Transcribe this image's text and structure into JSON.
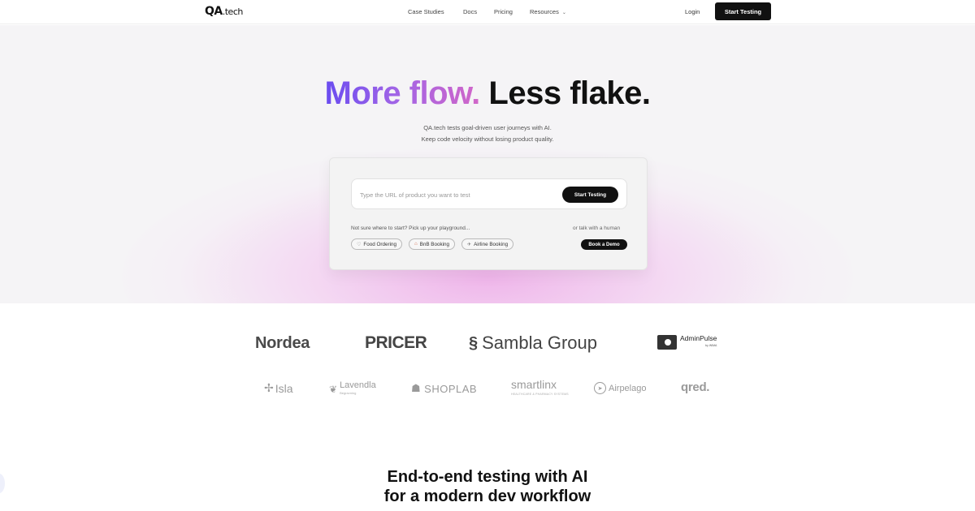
{
  "nav": {
    "logo_main": "QA",
    "logo_suffix": ".tech",
    "links": [
      "Case Studies",
      "Docs",
      "Pricing",
      "Resources"
    ],
    "login": "Login",
    "cta": "Start Testing"
  },
  "hero": {
    "headline_gradient": "More flow.",
    "headline_dark": "Less flake.",
    "subtitle_line1": "QA.tech tests goal-driven user journeys with AI.",
    "subtitle_line2": "Keep code velocity without losing product quality.",
    "url_placeholder": "Type the URL of product you want to test",
    "url_button": "Start Testing",
    "playground_text": "Not sure where to start? Pick up your playground...",
    "human_text": "or talk with a human",
    "chips": [
      "Food Ordering",
      "BnB Booking",
      "Airline Booking"
    ],
    "demo_button": "Book a Demo"
  },
  "logos": {
    "row1": [
      "Nordea",
      "PRICER",
      "Sambla Group",
      "AdminPulse"
    ],
    "adminpulse_byline": "by WIMA",
    "row2": [
      "Isla",
      "Lavendla",
      "SHOPLAB",
      "smartlinx",
      "Airpelago",
      "qred."
    ],
    "lavendla_byline": "Begravning",
    "smartlinx_byline": "HEALTHCARE & PHARMACY SYSTEMS"
  },
  "section": {
    "title_line1": "End-to-end testing with AI",
    "title_line2": "for a modern dev workflow"
  },
  "colors": {
    "gradient_start": "#6a4cf0",
    "gradient_end": "#d266c8",
    "button_dark": "#111111",
    "hero_glow": "#eeaae8"
  }
}
